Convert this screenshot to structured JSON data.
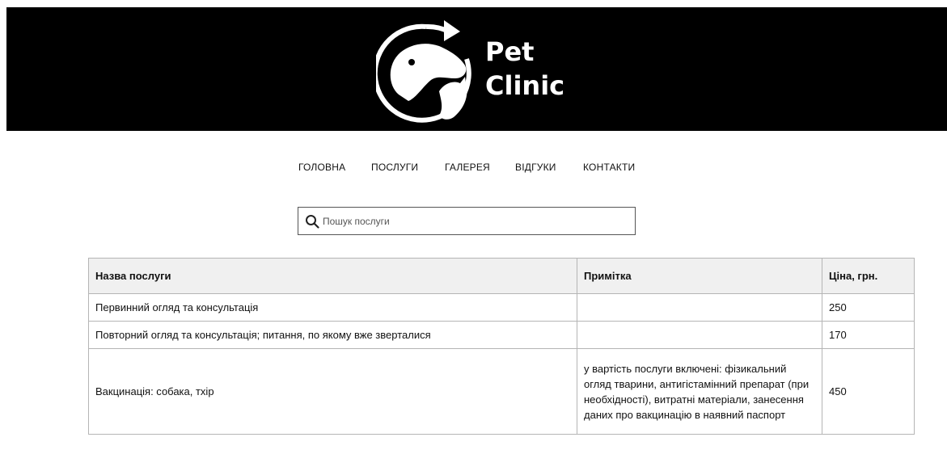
{
  "header": {
    "logo_line1": "Pet",
    "logo_line2": "Clinic",
    "background": "#000000"
  },
  "nav": {
    "items": [
      {
        "label": "ГОЛОВНА"
      },
      {
        "label": "ПОСЛУГИ"
      },
      {
        "label": "ГАЛЕРЕЯ"
      },
      {
        "label": "ВІДГУКИ"
      },
      {
        "label": "КОНТАКТИ"
      }
    ]
  },
  "search": {
    "placeholder": "Пошук послуги",
    "icon": "search-icon"
  },
  "table": {
    "headers": [
      "Назва послуги",
      "Примітка",
      "Ціна, грн."
    ],
    "rows": [
      {
        "name": "Первинний огляд та консультація",
        "note": "",
        "price": "250"
      },
      {
        "name": "Повторний огляд та консультація; питання, по якому вже зверталися",
        "note": "",
        "price": "170"
      },
      {
        "name": "Вакцинація: собака, тхір",
        "note": "у вартість послуги включені: фізикальний огляд тварини, антигістамінний препарат (при необхідності), витратні матеріали, занесення даних про вакцинацію в наявний паспорт",
        "price": "450"
      }
    ]
  }
}
